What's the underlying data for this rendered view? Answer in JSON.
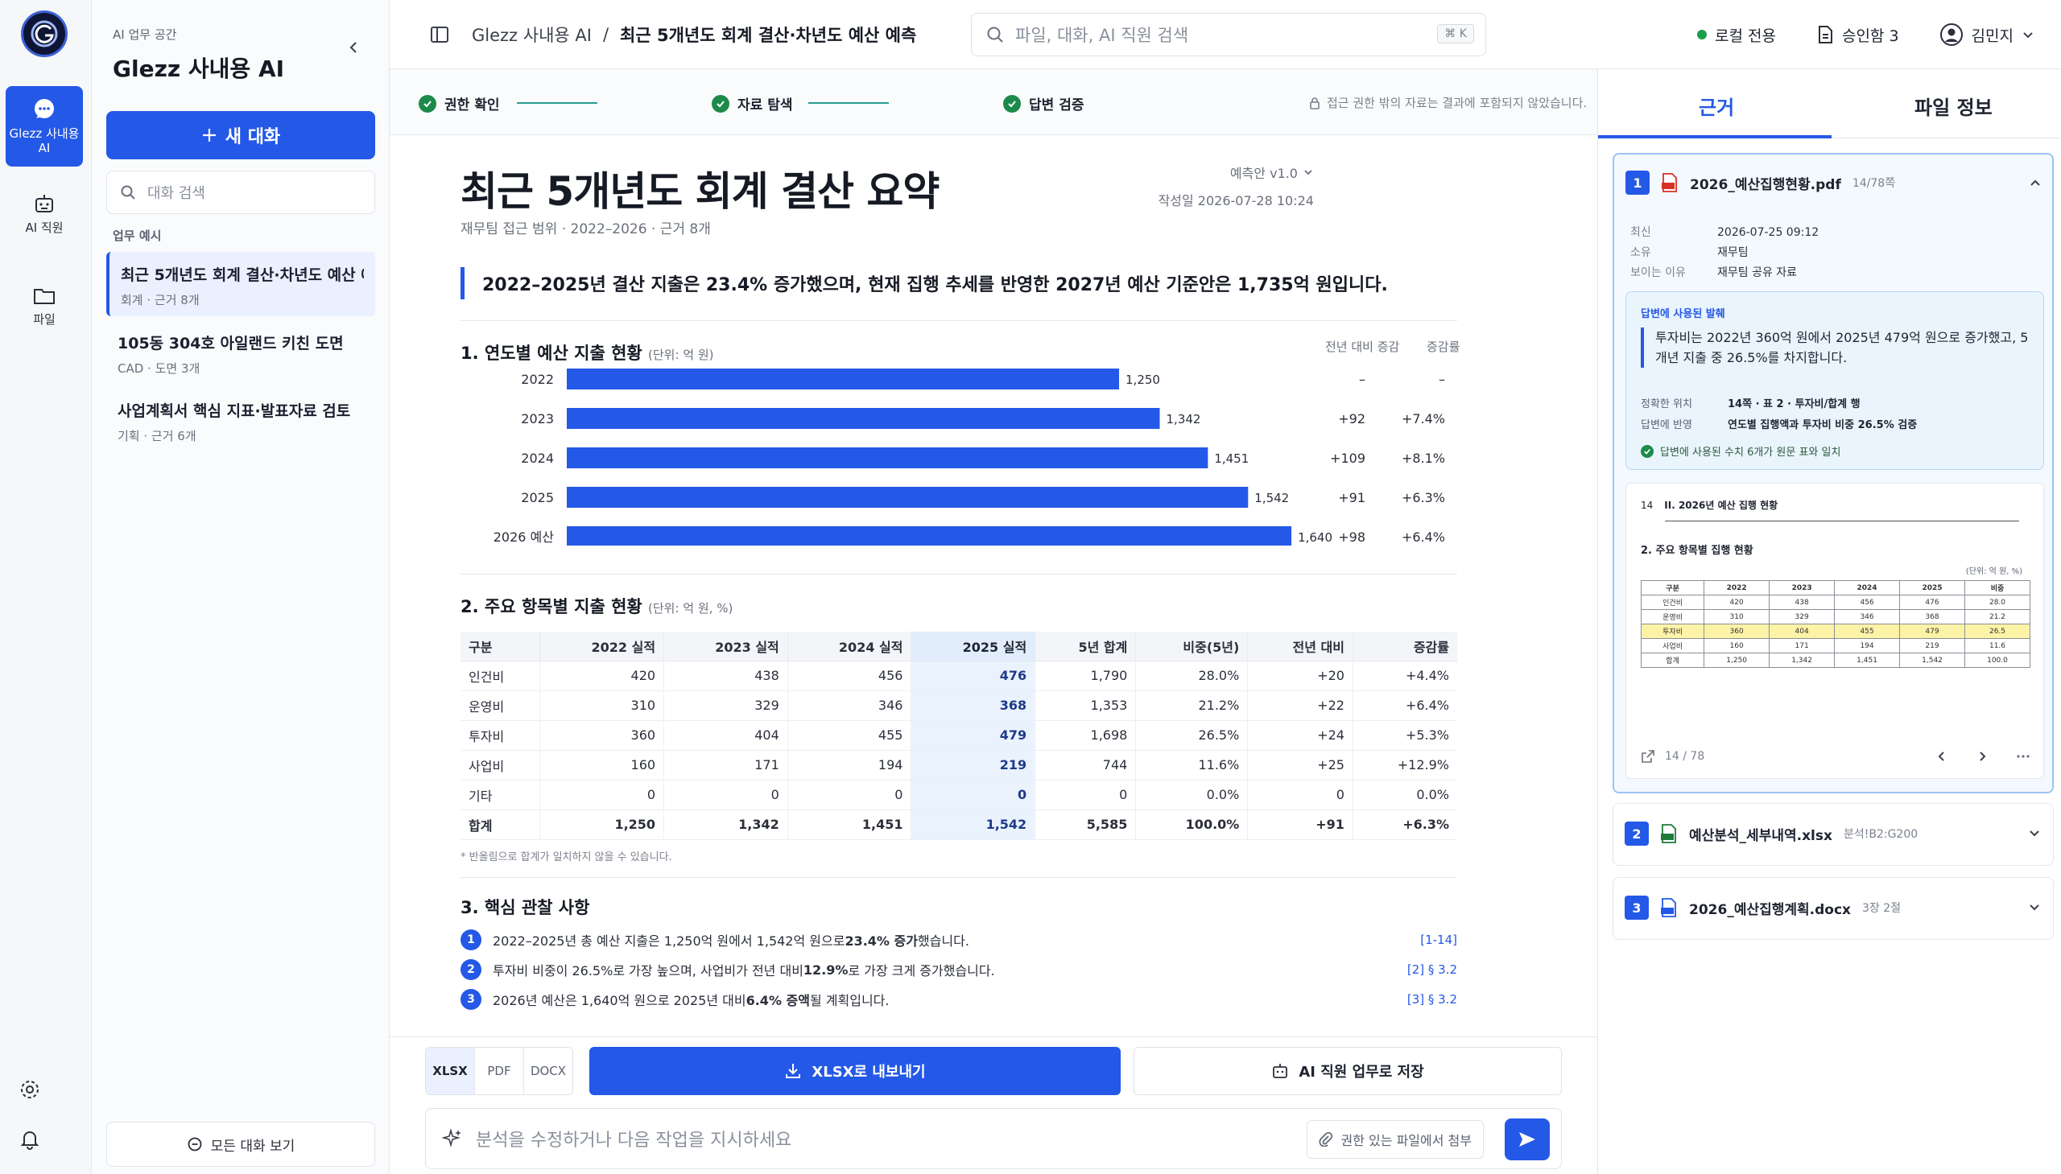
{
  "rail": {
    "items": [
      {
        "label": "Glezz 사내용 AI",
        "icon": "chat-bubble-icon",
        "active": true
      },
      {
        "label": "AI 직원",
        "icon": "robot-icon",
        "active": false
      },
      {
        "label": "파일",
        "icon": "folder-icon",
        "active": false
      }
    ]
  },
  "sidebar": {
    "workspace_label": "AI 업무 공간",
    "workspace_title": "Glezz 사내용 AI",
    "new_chat": "새 대화",
    "search_placeholder": "대화 검색",
    "section_label": "업무 예시",
    "chats": [
      {
        "title": "최근 5개년도 회계 결산·차년도 예산 예측",
        "sub": "회계 · 근거 8개",
        "active": true
      },
      {
        "title": "105동 304호 아일랜드 키친 도면",
        "sub": "CAD · 도면 3개",
        "active": false
      },
      {
        "title": "사업계획서 핵심 지표·발표자료 검토",
        "sub": "기획 · 근거 6개",
        "active": false
      }
    ],
    "all_chats": "모든 대화 보기"
  },
  "header": {
    "app_name": "Glezz 사내용 AI",
    "separator": "/",
    "page": "최근 5개년도 회계 결산·차년도 예산 예측",
    "search_placeholder": "파일, 대화, AI 직원 검색",
    "shortcut": "⌘ K",
    "local_only": "로컬 전용",
    "approval": "승인함 3",
    "user": "김민지"
  },
  "steps": [
    {
      "label": "권한 확인"
    },
    {
      "label": "자료 탐색"
    },
    {
      "label": "답변 검증"
    }
  ],
  "notice": "접근 권한 밖의 자료는 결과에 포함되지 않았습니다.",
  "doc": {
    "title": "최근 5개년도 회계 결산 요약",
    "meta": "재무팀 접근 범위 · 2022–2026 · 근거 8개",
    "version": "예측안 v1.0",
    "created": "작성일 2026-07-28 10:24",
    "summary": "2022–2025년 결산 지출은 23.4% 증가했으며, 현재 집행 추세를 반영한 2027년 예산 기준안은 1,735억 원입니다.",
    "section1": "1. 연도별 예산 지출 현황",
    "section1_unit": "(단위: 억 원)",
    "col_diff": "전년 대비 증감",
    "col_rate": "증감률",
    "section2": "2. 주요 항목별 지출 현황",
    "section2_unit": "(단위: 억 원, %)",
    "footnote": "* 반올림으로 합계가 일치하지 않을 수 있습니다.",
    "section3": "3. 핵심 관찰 사항",
    "observations": [
      {
        "num": "1",
        "pre": "2022–2025년 총 예산 지출은 1,250억 원에서 1,542억 원으로 ",
        "strong": "23.4% 증가",
        "post": "했습니다.",
        "ref": "[1-14]"
      },
      {
        "num": "2",
        "pre": "투자비 비중이 26.5%로 가장 높으며, 사업비가 전년 대비 ",
        "strong": "12.9%",
        "post": "로 가장 크게 증가했습니다.",
        "ref": "[2] § 3.2"
      },
      {
        "num": "3",
        "pre": "2026년 예산은 1,640억 원으로 2025년 대비 ",
        "strong": "6.4% 증액",
        "post": "될 계획입니다.",
        "ref": "[3] § 3.2"
      }
    ]
  },
  "chart_data": {
    "type": "bar",
    "orientation": "horizontal",
    "categories": [
      "2022",
      "2023",
      "2024",
      "2025",
      "2026 예산"
    ],
    "values": [
      1250,
      1342,
      1451,
      1542,
      1640
    ],
    "value_labels": [
      "1,250",
      "1,342",
      "1,451",
      "1,542",
      "1,640"
    ],
    "xlim": [
      0,
      1700
    ],
    "xticks": [
      0,
      500,
      1000,
      1500,
      1700
    ],
    "xtick_labels": [
      "0",
      "500",
      "1,000",
      "1,500",
      "1,700"
    ],
    "diff": [
      "–",
      "+92",
      "+109",
      "+91",
      "+98"
    ],
    "rate": [
      "–",
      "+7.4%",
      "+8.1%",
      "+6.3%",
      "+6.4%"
    ],
    "color": "#2458e6"
  },
  "table": {
    "headers": [
      "구분",
      "2022 실적",
      "2023 실적",
      "2024 실적",
      "2025 실적",
      "5년 합계",
      "비중(5년)",
      "전년 대비",
      "증감률"
    ],
    "rows": [
      [
        "인건비",
        "420",
        "438",
        "456",
        "476",
        "1,790",
        "28.0%",
        "+20",
        "+4.4%"
      ],
      [
        "운영비",
        "310",
        "329",
        "346",
        "368",
        "1,353",
        "21.2%",
        "+22",
        "+6.4%"
      ],
      [
        "투자비",
        "360",
        "404",
        "455",
        "479",
        "1,698",
        "26.5%",
        "+24",
        "+5.3%"
      ],
      [
        "사업비",
        "160",
        "171",
        "194",
        "219",
        "744",
        "11.6%",
        "+25",
        "+12.9%"
      ],
      [
        "기타",
        "0",
        "0",
        "0",
        "0",
        "0",
        "0.0%",
        "0",
        "0.0%"
      ],
      [
        "합계",
        "1,250",
        "1,342",
        "1,451",
        "1,542",
        "5,585",
        "100.0%",
        "+91",
        "+6.3%"
      ]
    ]
  },
  "bottom": {
    "formats": [
      "XLSX",
      "PDF",
      "DOCX"
    ],
    "export": "XLSX로 내보내기",
    "save_job": "AI 직원 업무로 저장",
    "prompt_placeholder": "분석을 수정하거나 다음 작업을 지시하세요",
    "attach": "권한 있는 파일에서 첨부"
  },
  "rpanel": {
    "tab_evidence": "근거",
    "tab_fileinfo": "파일 정보",
    "card1": {
      "num": "1",
      "filename": "2026_예산집행현황.pdf",
      "pages": "14/78쪽",
      "latest_k": "최신",
      "latest_v": "2026-07-25 09:12",
      "owner_k": "소유",
      "owner_v": "재무팀",
      "why_k": "보이는 이유",
      "why_v": "재무팀 공유 자료",
      "quote_label": "답변에 사용된 발췌",
      "quote": "투자비는 2022년 360억 원에서 2025년 479억 원으로 증가했고, 5개년 지출 중 26.5%를 차지합니다.",
      "pos_k": "정확한 위치",
      "pos_v": "14쪽 · 표 2 · 투자비/합계 행",
      "refl_k": "답변에 반영",
      "refl_v": "연도별 집행액과 투자비 비중 26.5% 검증",
      "ok": "답변에 사용된 수치 6개가 원문 표와 일치",
      "preview": {
        "page": "14",
        "heading": "II. 2026년 예산 집행 현황",
        "sub": "2. 주요 항목별 집행 현황",
        "unit": "(단위: 억 원, %)",
        "headers": [
          "구분",
          "2022",
          "2023",
          "2024",
          "2025",
          "비중"
        ],
        "rows": [
          [
            "인건비",
            "420",
            "438",
            "456",
            "476",
            "28.0"
          ],
          [
            "운영비",
            "310",
            "329",
            "346",
            "368",
            "21.2"
          ],
          [
            "투자비",
            "360",
            "404",
            "455",
            "479",
            "26.5"
          ],
          [
            "사업비",
            "160",
            "171",
            "194",
            "219",
            "11.6"
          ],
          [
            "합계",
            "1,250",
            "1,342",
            "1,451",
            "1,542",
            "100.0"
          ]
        ],
        "page_indicator": "14 / 78"
      }
    },
    "card2": {
      "num": "2",
      "filename": "예산분석_세부내역.xlsx",
      "sub": "분석!B2:G200"
    },
    "card3": {
      "num": "3",
      "filename": "2026_예산집행계획.docx",
      "sub": "3장 2절"
    }
  }
}
